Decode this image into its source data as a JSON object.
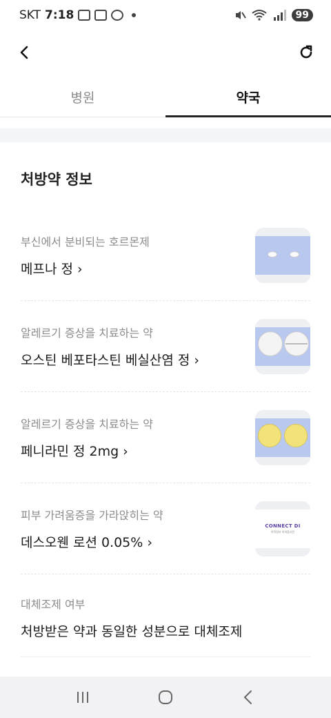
{
  "status_bar": {
    "carrier": "SKT",
    "time": "7:18",
    "battery": "99",
    "network": "5"
  },
  "tabs": [
    {
      "label": "병원",
      "active": false
    },
    {
      "label": "약국",
      "active": true
    }
  ],
  "section": {
    "title": "처방약 정보"
  },
  "medications": [
    {
      "description": "부신에서 분비되는 호르몬제",
      "name": "메프나 정 ›",
      "image": "white-tablets"
    },
    {
      "description": "알레르기 증상을 치료하는 약",
      "name": "오스틴 베포타스틴 베실산염 정 ›",
      "image": "white-scored-tablets"
    },
    {
      "description": "알레르기 증상을 치료하는 약",
      "name": "페니라민 정 2mg ›",
      "image": "yellow-tablets"
    },
    {
      "description": "피부 가려움증을 가라앉히는 약",
      "name": "데스오웬 로션 0.05% ›",
      "image": "lotion-leaflet"
    }
  ],
  "leaflet": {
    "logo": "CONNECT DI",
    "subtitle": "약학정보 의약품사전"
  },
  "substitution": {
    "label": "대체조제 여부",
    "value": "처방받은 약과 동일한 성분으로 대체조제"
  },
  "colors": {
    "active_tab": "#222222",
    "muted_text": "#8c8c8c",
    "pill_card": "#b8c8ee",
    "yellow_pill": "#f2e27a"
  }
}
